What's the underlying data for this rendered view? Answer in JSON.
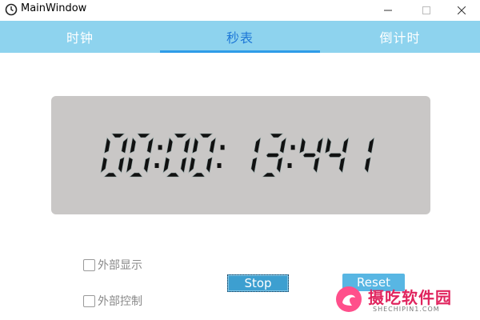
{
  "window": {
    "title": "MainWindow"
  },
  "tabs": [
    {
      "label": "时钟",
      "active": false
    },
    {
      "label": "秒表",
      "active": true
    },
    {
      "label": "倒计时",
      "active": false
    }
  ],
  "display": {
    "time": "00:00: 13:441"
  },
  "options": {
    "external_display": {
      "label": "外部显示",
      "checked": false
    },
    "external_control": {
      "label": "外部控制",
      "checked": false
    }
  },
  "buttons": {
    "stop_label": "Stop",
    "reset_label": "Reset"
  },
  "watermark": {
    "name": "摄吃软件园",
    "sub": "SHECHIPIN1.COM"
  },
  "colors": {
    "tab_bar": "#8ed3ee",
    "active_tab": "#1e78d7",
    "display_bg": "#c9c7c6",
    "digits": "#111111",
    "button": "#3d9fd0"
  }
}
